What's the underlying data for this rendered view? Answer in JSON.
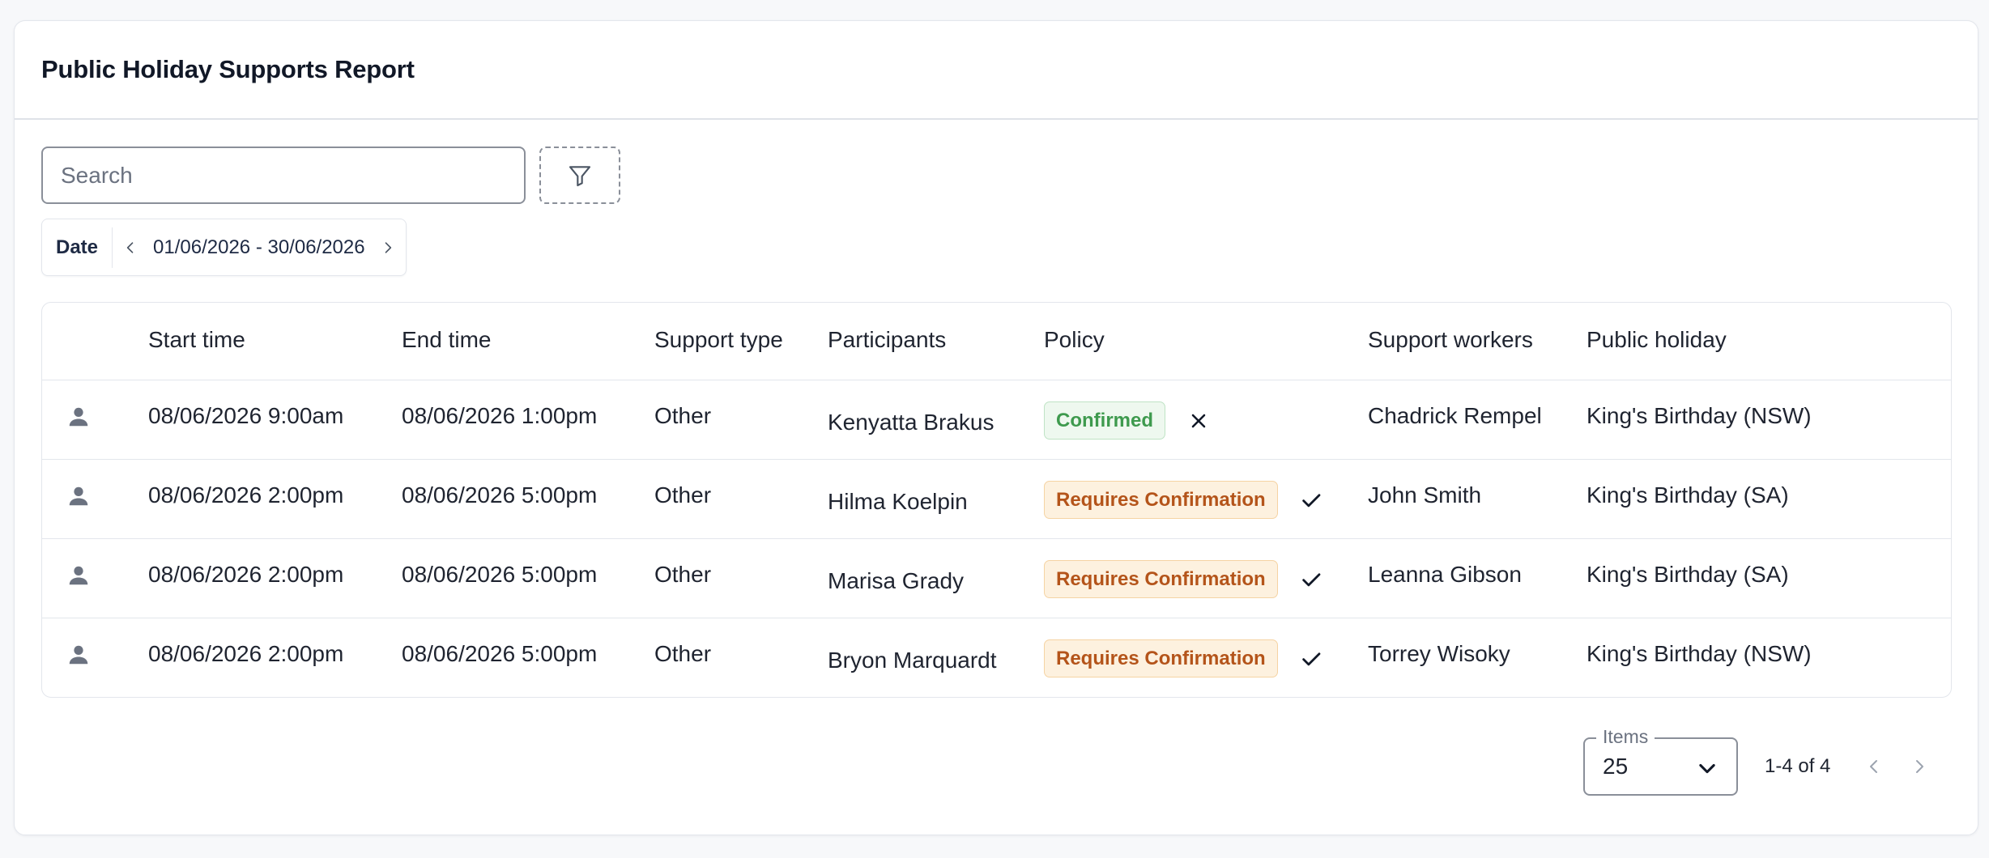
{
  "page": {
    "title": "Public Holiday Supports Report"
  },
  "search": {
    "placeholder": "Search"
  },
  "date_filter": {
    "label": "Date",
    "range": "01/06/2026 - 30/06/2026"
  },
  "table": {
    "headers": [
      "Start time",
      "End time",
      "Support type",
      "Participants",
      "Policy",
      "Support workers",
      "Public holiday"
    ],
    "rows": [
      {
        "start": "08/06/2026 9:00am",
        "end": "08/06/2026 1:00pm",
        "type": "Other",
        "participant": "Kenyatta Brakus",
        "policy": "Confirmed",
        "policy_status": "confirmed",
        "action_icon": "x-icon",
        "worker": "Chadrick Rempel",
        "holiday": "King's Birthday (NSW)"
      },
      {
        "start": "08/06/2026 2:00pm",
        "end": "08/06/2026 5:00pm",
        "type": "Other",
        "participant": "Hilma Koelpin",
        "policy": "Requires Confirmation",
        "policy_status": "requires",
        "action_icon": "check-icon",
        "worker": "John Smith",
        "holiday": "King's Birthday (SA)"
      },
      {
        "start": "08/06/2026 2:00pm",
        "end": "08/06/2026 5:00pm",
        "type": "Other",
        "participant": "Marisa Grady",
        "policy": "Requires Confirmation",
        "policy_status": "requires",
        "action_icon": "check-icon",
        "worker": "Leanna Gibson",
        "holiday": "King's Birthday (SA)"
      },
      {
        "start": "08/06/2026 2:00pm",
        "end": "08/06/2026 5:00pm",
        "type": "Other",
        "participant": "Bryon Marquardt",
        "policy": "Requires Confirmation",
        "policy_status": "requires",
        "action_icon": "check-icon",
        "worker": "Torrey Wisoky",
        "holiday": "King's Birthday (NSW)"
      }
    ]
  },
  "pagination": {
    "items_label": "Items",
    "items_value": "25",
    "range_text": "1-4 of 4"
  },
  "colors": {
    "confirmed_text": "#3e9a4e",
    "confirmed_bg": "#eef8ef",
    "requires_text": "#b4541a",
    "requires_bg": "#fdf1df",
    "icon_gray": "#6b7280"
  }
}
